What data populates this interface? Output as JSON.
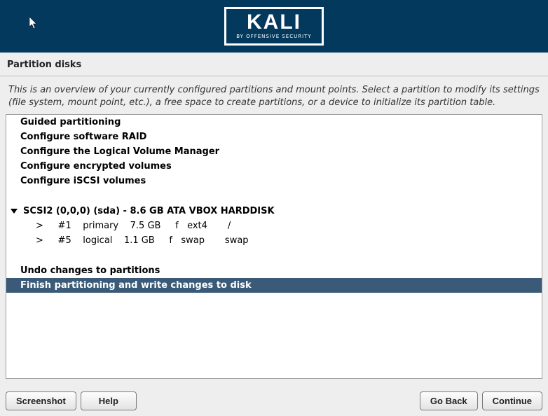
{
  "header": {
    "logo_main": "KALI",
    "logo_sub": "BY OFFENSIVE SECURITY"
  },
  "page_title": "Partition disks",
  "description": "This is an overview of your currently configured partitions and mount points. Select a partition to modify its settings (file system, mount point, etc.), a free space to create partitions, or a device to initialize its partition table.",
  "menu": {
    "guided": "Guided partitioning",
    "raid": "Configure software RAID",
    "lvm": "Configure the Logical Volume Manager",
    "encrypted": "Configure encrypted volumes",
    "iscsi": "Configure iSCSI volumes"
  },
  "device": {
    "label": "SCSI2 (0,0,0) (sda) - 8.6 GB ATA VBOX HARDDISK",
    "partitions": [
      {
        "marker": ">",
        "num": "#1",
        "type": "primary",
        "size": "7.5 GB",
        "flag": "f",
        "fs": "ext4",
        "mount": "/"
      },
      {
        "marker": ">",
        "num": "#5",
        "type": "logical",
        "size": "1.1 GB",
        "flag": "f",
        "fs": "swap",
        "mount": "swap"
      }
    ]
  },
  "actions": {
    "undo": "Undo changes to partitions",
    "finish": "Finish partitioning and write changes to disk"
  },
  "buttons": {
    "screenshot": "Screenshot",
    "help": "Help",
    "goback": "Go Back",
    "continue": "Continue"
  }
}
